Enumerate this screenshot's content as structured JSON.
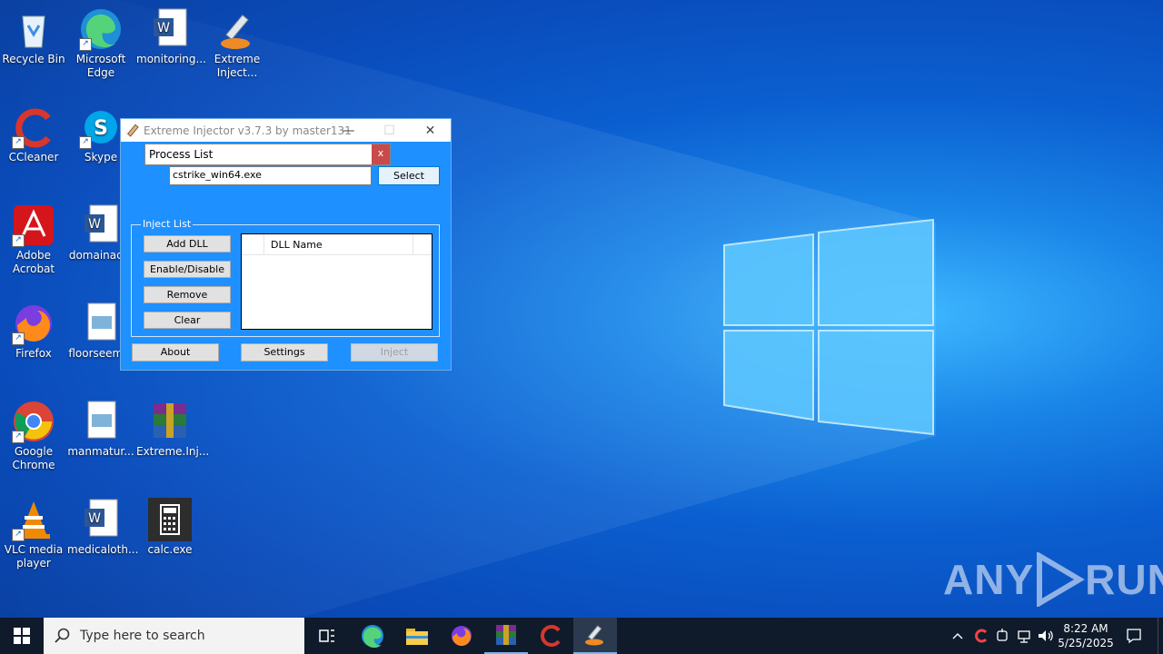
{
  "desktop": {
    "icons": [
      {
        "label": "Recycle Bin"
      },
      {
        "label": "Microsoft Edge"
      },
      {
        "label": "monitoring..."
      },
      {
        "label": "Extreme Inject..."
      },
      {
        "label": "CCleaner"
      },
      {
        "label": "Skype"
      },
      {
        "label": "Adobe Acrobat"
      },
      {
        "label": "domainac..."
      },
      {
        "label": "Firefox"
      },
      {
        "label": "floorseem..."
      },
      {
        "label": "Google Chrome"
      },
      {
        "label": "manmatur..."
      },
      {
        "label": "Extreme.Inj..."
      },
      {
        "label": "VLC media player"
      },
      {
        "label": "medicaloth..."
      },
      {
        "label": "calc.exe"
      }
    ],
    "watermark": {
      "left": "ANY",
      "right": "RUN"
    }
  },
  "window": {
    "title": "Extreme Injector v3.7.3 by master131",
    "process_list": {
      "label": "Process List",
      "close": "x"
    },
    "process_value": "cstrike_win64.exe",
    "select_button": "Select",
    "inject_list": {
      "label": "Inject List",
      "column_header": "DLL Name",
      "buttons": {
        "add": "Add DLL",
        "toggle": "Enable/Disable",
        "remove": "Remove",
        "clear": "Clear"
      }
    },
    "bottom": {
      "about": "About",
      "settings": "Settings",
      "inject": "Inject"
    }
  },
  "taskbar": {
    "search_placeholder": "Type here to search",
    "clock": {
      "time": "8:22 AM",
      "date": "5/25/2025"
    }
  },
  "colors": {
    "accent": "#1e90ff",
    "taskbar": "#0f1b2b"
  }
}
